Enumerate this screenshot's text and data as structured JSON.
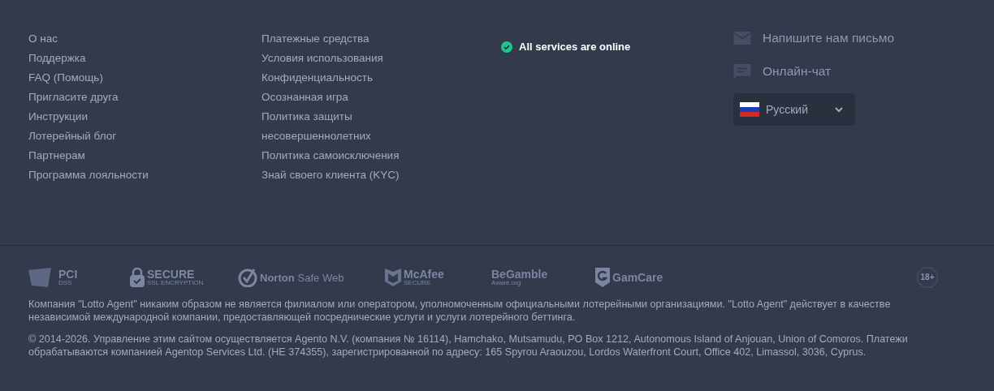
{
  "links_column_1": [
    "О нас",
    "Поддержка",
    "FAQ (Помощь)",
    "Пригласите друга",
    "Инструкции",
    "Лотерейный блог",
    "Партнерам",
    "Программа лояльности"
  ],
  "links_column_2": [
    "Платежные средства",
    "Условия использования",
    "Конфиденциальность",
    "Осознанная игра",
    "Политика защиты",
    "несовершеннолетних",
    "Политика самоисключения",
    "Знай своего клиента (KYC)"
  ],
  "status": {
    "text": "All services are online",
    "online": true
  },
  "contacts": [
    {
      "kind": "mail",
      "label": "Напишите нам письмо"
    },
    {
      "kind": "chat",
      "label": "Онлайн-чат"
    }
  ],
  "language": {
    "label": "Русский"
  },
  "badges": [
    {
      "kind": "pci",
      "text": "PCI",
      "subtext": "DSS"
    },
    {
      "kind": "lock",
      "text": "SECURE",
      "subtext": "SSL ENCRYPTION"
    },
    {
      "kind": "norton",
      "text": "Norton",
      "subtext": "Safe Web"
    },
    {
      "kind": "mcafee",
      "text": "McAfee",
      "subtext": "SECURE"
    },
    {
      "kind": "begamble",
      "text": "BeGamble",
      "subtext": "Aware.org"
    },
    {
      "kind": "gamcare",
      "text": "GamCare"
    },
    {
      "kind": "age",
      "text": "18+"
    }
  ],
  "disclaimer": "Компания \"Lotto Agent\" никаким образом не является филиалом или оператором, уполномоченным официальными лотерейными организациями. \"Lotto Agent\" действует в качестве независимой международной компании, предоставляющей посреднические услуги и услуги лотерейного беттинга.",
  "copyright": "© 2014-2026. Управление этим сайтом осуществляется Agento N.V. (компания № 16114), Hamchako, Mutsamudu, PO Box 1212, Autonomous Island of Anjouan, Union of Comoros. Платежи обрабатываются компанией Agentop Services Ltd. (HE 374355), зарегистрированной по адресу: 165 Spyrou Araouzou, Lordos Waterfront Court, Office 402, Limassol, 3036, Cyprus."
}
